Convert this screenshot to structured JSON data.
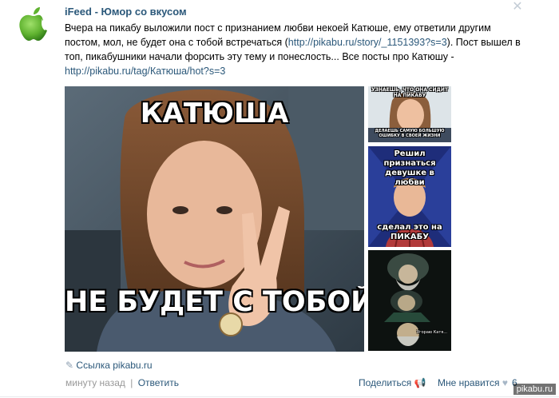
{
  "post": {
    "author": "iFeed - Юмор со вкусом",
    "text_before_link1": "Вчера на пикабу выложили пост с признанием любви некоей Катюше, ему ответили другим постом, мол, не будет она с тобой встречаться (",
    "link1": "http://pikabu.ru/story/_1151393?s=3",
    "text_between_links": "). Пост вышел в топ, пикабушники начали форсить эту тему и понеслость... Все посты про Катюшу - ",
    "link2": "http://pikabu.ru/tag/Катюша/hot?s=3"
  },
  "images": {
    "main_top_caption": "КАТЮША",
    "main_bottom_caption": "НЕ БУДЕТ С ТОБОЙ ДРУЖИ",
    "thumb1_top": "УЗНАЕШЬ, ЧТО ОНА СИДИТ НА ПИКАБУ",
    "thumb1_bottom": "ДЕЛАЕШЬ САМУЮ БОЛЬШУЮ ОШИБКУ В СВОЕЙ ЖИЗНИ",
    "thumb2_top": "Решил признаться девушке в любви",
    "thumb2_bottom": "сделал это на ПИКАБУ",
    "thumb3_caption": "Угораю Катя..."
  },
  "footer": {
    "link_label": "Ссылка",
    "link_domain": "pikabu.ru",
    "time": "минуту назад",
    "separator": "|",
    "reply": "Ответить",
    "share": "Поделиться",
    "like": "Мне нравится",
    "like_count": "6"
  },
  "watermark": "pikabu.ru",
  "colors": {
    "link": "#2b587a",
    "muted": "#999999",
    "logo_green": "#5fb22f"
  }
}
